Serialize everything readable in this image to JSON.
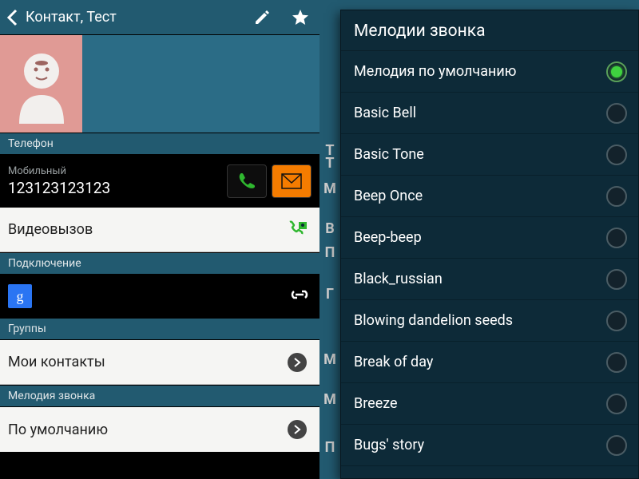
{
  "left": {
    "title": "Контакт, Тест",
    "sections": {
      "phone_header": "Телефон",
      "phone_type": "Мобильный",
      "phone_number": "123123123123",
      "videocall": "Видеовызов",
      "connection_header": "Подключение",
      "google_badge": "g",
      "groups_header": "Группы",
      "groups_value": "Мои контакты",
      "ringtone_header": "Мелодия звонка",
      "ringtone_value": "По умолчанию"
    }
  },
  "right": {
    "dialog_title": "Мелодии звонка",
    "options": [
      {
        "label": "Мелодия по умолчанию",
        "selected": true
      },
      {
        "label": "Basic Bell",
        "selected": false
      },
      {
        "label": "Basic Tone",
        "selected": false
      },
      {
        "label": "Beep Once",
        "selected": false
      },
      {
        "label": "Beep-beep",
        "selected": false
      },
      {
        "label": "Black_russian",
        "selected": false
      },
      {
        "label": "Blowing dandelion seeds",
        "selected": false
      },
      {
        "label": "Break of day",
        "selected": false
      },
      {
        "label": "Breeze",
        "selected": false
      },
      {
        "label": "Bugs' story",
        "selected": false
      }
    ],
    "ghost_letters": [
      "Т",
      "Т",
      "М",
      "В",
      "П",
      "Г",
      "М",
      "М",
      "П"
    ]
  }
}
